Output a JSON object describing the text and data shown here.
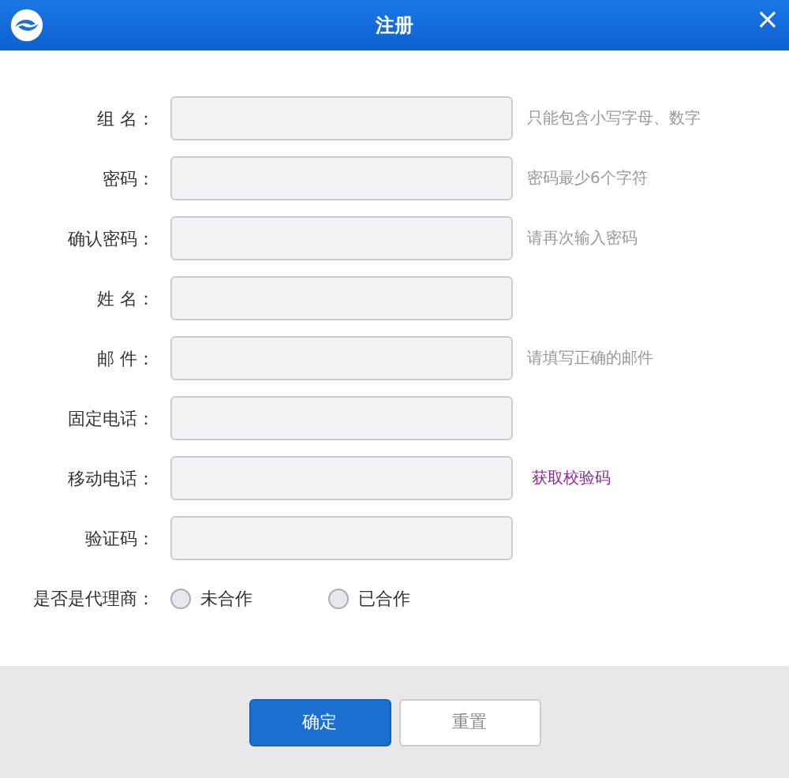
{
  "window": {
    "title": "注册",
    "close": "×"
  },
  "fields": [
    {
      "label": "组 名：",
      "note": {
        "kind": "hint",
        "text": "只能包含小写字母、数字"
      }
    },
    {
      "label": "密码：",
      "note": {
        "kind": "hint",
        "text": "密码最少6个字符"
      }
    },
    {
      "label": "确认密码：",
      "note": {
        "kind": "hint",
        "text": "请再次输入密码"
      }
    },
    {
      "label": "姓 名："
    },
    {
      "label": "邮 件：",
      "note": {
        "kind": "hint",
        "text": "请填写正确的邮件"
      }
    },
    {
      "label": "固定电话："
    },
    {
      "label": "移动电话：",
      "note": {
        "kind": "link",
        "text": "获取校验码"
      }
    },
    {
      "label": "验证码："
    }
  ],
  "agent": {
    "label": "是否是代理商：",
    "options": [
      {
        "label": "未合作",
        "selected": false
      },
      {
        "label": "已合作",
        "selected": false
      }
    ]
  },
  "buttons": [
    {
      "label": "确定",
      "kind": "primary"
    },
    {
      "label": "重置",
      "kind": "secondary"
    }
  ]
}
